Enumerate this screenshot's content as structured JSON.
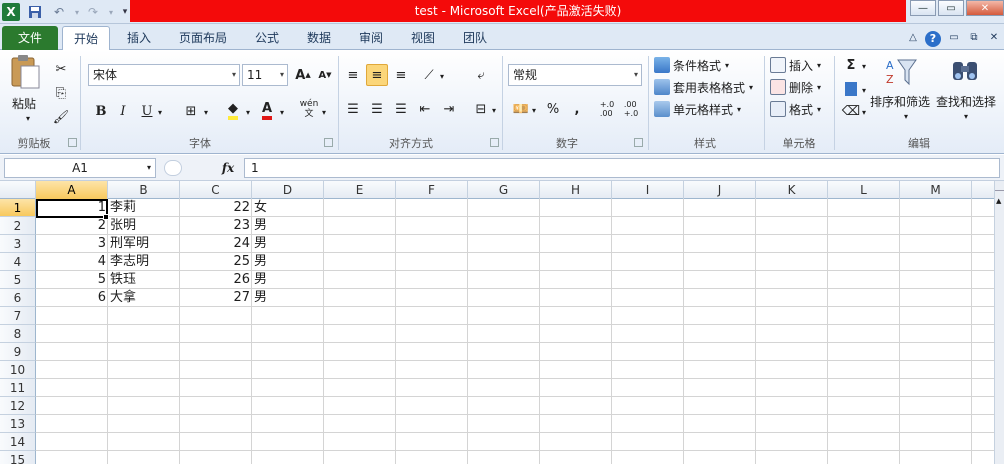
{
  "window": {
    "title": "test  -  Microsoft Excel(产品激活失败)"
  },
  "qat": {
    "excel_icon": "X",
    "save_icon": "save-icon",
    "undo_icon": "undo-icon",
    "redo_icon": "redo-icon"
  },
  "tabs": [
    "文件",
    "开始",
    "插入",
    "页面布局",
    "公式",
    "数据",
    "审阅",
    "视图",
    "团队"
  ],
  "ribbon": {
    "clipboard": {
      "paste": "粘贴",
      "label": "剪贴板"
    },
    "font": {
      "name": "宋体",
      "size": "11",
      "label": "字体",
      "bold": "B",
      "italic": "I",
      "underline": "U",
      "grow": "A",
      "shrink": "A",
      "font_color_label": "A",
      "wen": "wén"
    },
    "alignment": {
      "label": "对齐方式"
    },
    "number": {
      "format": "常规",
      "label": "数字",
      "percent": "%",
      "comma": ",",
      "inc_dec": "+.0\n.00",
      "dec_dec": ".00\n+.0"
    },
    "styles": {
      "conditional": "条件格式",
      "table": "套用表格格式",
      "cell_styles": "单元格样式",
      "label": "样式"
    },
    "cells": {
      "insert": "插入",
      "delete": "删除",
      "format": "格式",
      "label": "单元格"
    },
    "editing": {
      "sum": "Σ",
      "sort_filter": "排序和筛选",
      "find_select": "查找和选择",
      "label": "编辑"
    }
  },
  "formula_bar": {
    "name_box": "A1",
    "fx": "fx",
    "value": "1"
  },
  "sheet": {
    "columns": [
      "A",
      "B",
      "C",
      "D",
      "E",
      "F",
      "G",
      "H",
      "I",
      "J",
      "K",
      "L",
      "M"
    ],
    "row_numbers": [
      "1",
      "2",
      "3",
      "4",
      "5",
      "6",
      "7",
      "8",
      "9",
      "10",
      "11",
      "12",
      "13",
      "14",
      "15"
    ],
    "rows": [
      [
        "1",
        "李莉",
        "22",
        "女"
      ],
      [
        "2",
        "张明",
        "23",
        "男"
      ],
      [
        "3",
        "刑军明",
        "24",
        "男"
      ],
      [
        "4",
        "李志明",
        "25",
        "男"
      ],
      [
        "5",
        "铁珏",
        "26",
        "男"
      ],
      [
        "6",
        "大拿",
        "27",
        "男"
      ]
    ],
    "active_cell": "A1"
  },
  "colors": {
    "title_highlight": "#f40a0a",
    "file_tab": "#2b7a2e",
    "selection_header": "#f8c95e"
  }
}
